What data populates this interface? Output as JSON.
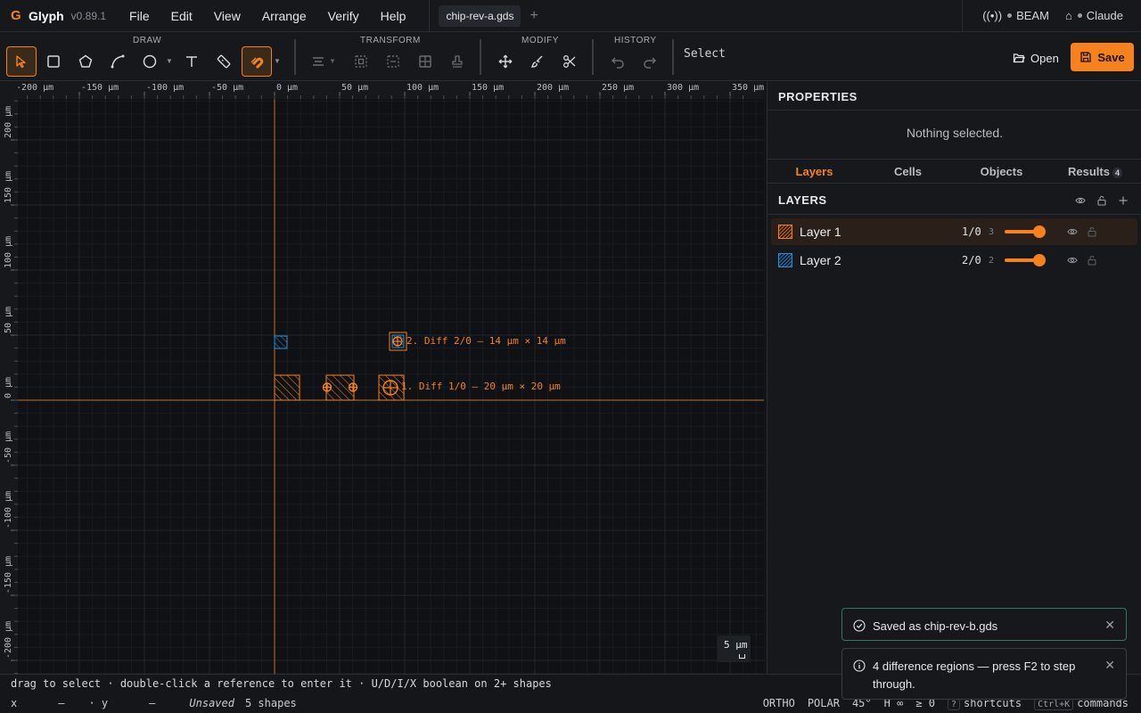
{
  "app": {
    "name": "Glyph",
    "version": "v0.89.1"
  },
  "menu": [
    "File",
    "Edit",
    "View",
    "Arrange",
    "Verify",
    "Help"
  ],
  "tab": {
    "name": "chip-rev-a.gds",
    "add": "+"
  },
  "topright": {
    "beam": "BEAM",
    "claude": "Claude"
  },
  "toolbar": {
    "groups": {
      "draw": "DRAW",
      "transform": "TRANSFORM",
      "modify": "MODIFY",
      "history": "HISTORY"
    },
    "mode": "Select",
    "open": "Open",
    "save": "Save"
  },
  "ruler": {
    "x_ticks": [
      "-200 µm",
      "-150 µm",
      "-100 µm",
      "-50 µm",
      "0 µm",
      "50 µm",
      "100 µm",
      "150 µm",
      "200 µm",
      "250 µm",
      "300 µm",
      "350 µm"
    ],
    "y_ticks": [
      "200 µm",
      "150 µm",
      "100 µm",
      "50 µm",
      "0 µm",
      "-50 µm",
      "-100 µm",
      "-150 µm",
      "-200 µm"
    ]
  },
  "canvas": {
    "diff1": "1. Diff 1/0 — 20 µm × 20 µm",
    "diff2": "2. Diff 2/0 — 14 µm × 14 µm",
    "scale": "5 µm",
    "accent": "#f5821f",
    "layer2_color": "#2a8fd8"
  },
  "properties": {
    "title": "PROPERTIES",
    "empty": "Nothing selected."
  },
  "panel_tabs": {
    "layers": "Layers",
    "cells": "Cells",
    "objects": "Objects",
    "results": "Results",
    "results_count": "4"
  },
  "layers": {
    "title": "LAYERS",
    "items": [
      {
        "name": "Layer 1",
        "datatype": "1/0",
        "count": "3",
        "color": "#f5821f"
      },
      {
        "name": "Layer 2",
        "datatype": "2/0",
        "count": "2",
        "color": "#2a8fd8"
      }
    ]
  },
  "status": {
    "hint": "drag to select · double-click a reference to enter it · U/D/I/X boolean on 2+ shapes",
    "x_label": "x",
    "x_val": "—",
    "y_label": "· y",
    "y_val": "—",
    "saved": "Unsaved",
    "shapes": "5 shapes",
    "ortho": "ORTHO",
    "polar": "POLAR",
    "angle": "45°",
    "h": "H ∞",
    "ge": "≥ 0",
    "shortcuts_key": "?",
    "shortcuts": "shortcuts",
    "commands_key": "Ctrl+K",
    "commands": "commands"
  },
  "toasts": [
    {
      "text": "Saved as chip-rev-b.gds"
    },
    {
      "text": "4 difference regions — press F2 to step through."
    }
  ]
}
